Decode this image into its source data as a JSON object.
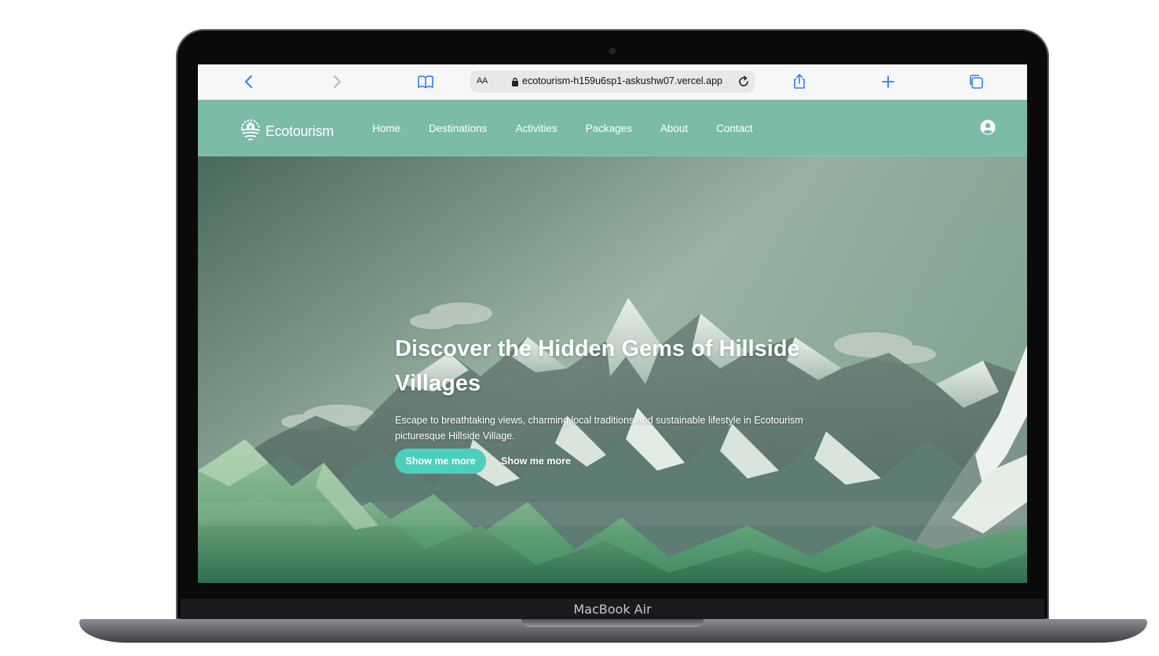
{
  "device": {
    "label": "MacBook Air"
  },
  "browser": {
    "text_size_label": "AA",
    "url": "ecotourism-h159u6sp1-askushw07.vercel.app",
    "icons": [
      "back-icon",
      "forward-icon",
      "bookmarks-icon",
      "lock-icon",
      "reload-icon",
      "share-icon",
      "new-tab-icon",
      "tabs-icon"
    ]
  },
  "site": {
    "brand": "Ecotourism",
    "nav": [
      "Home",
      "Destinations",
      "Activities",
      "Packages",
      "About",
      "Contact"
    ],
    "hero": {
      "title": "Discover the Hidden Gems of Hillside Villages",
      "subtitle": "Escape to breathtaking views, charming local traditions and sustainable lifestyle in Ecotourism picturesque Hillside Village.",
      "primary_button": "Show me more",
      "secondary_button": "Show me more"
    }
  },
  "colors": {
    "nav_bg": "#7bbba8",
    "button_primary": "#4ccfbf",
    "safari_accent": "#1a73e8"
  }
}
